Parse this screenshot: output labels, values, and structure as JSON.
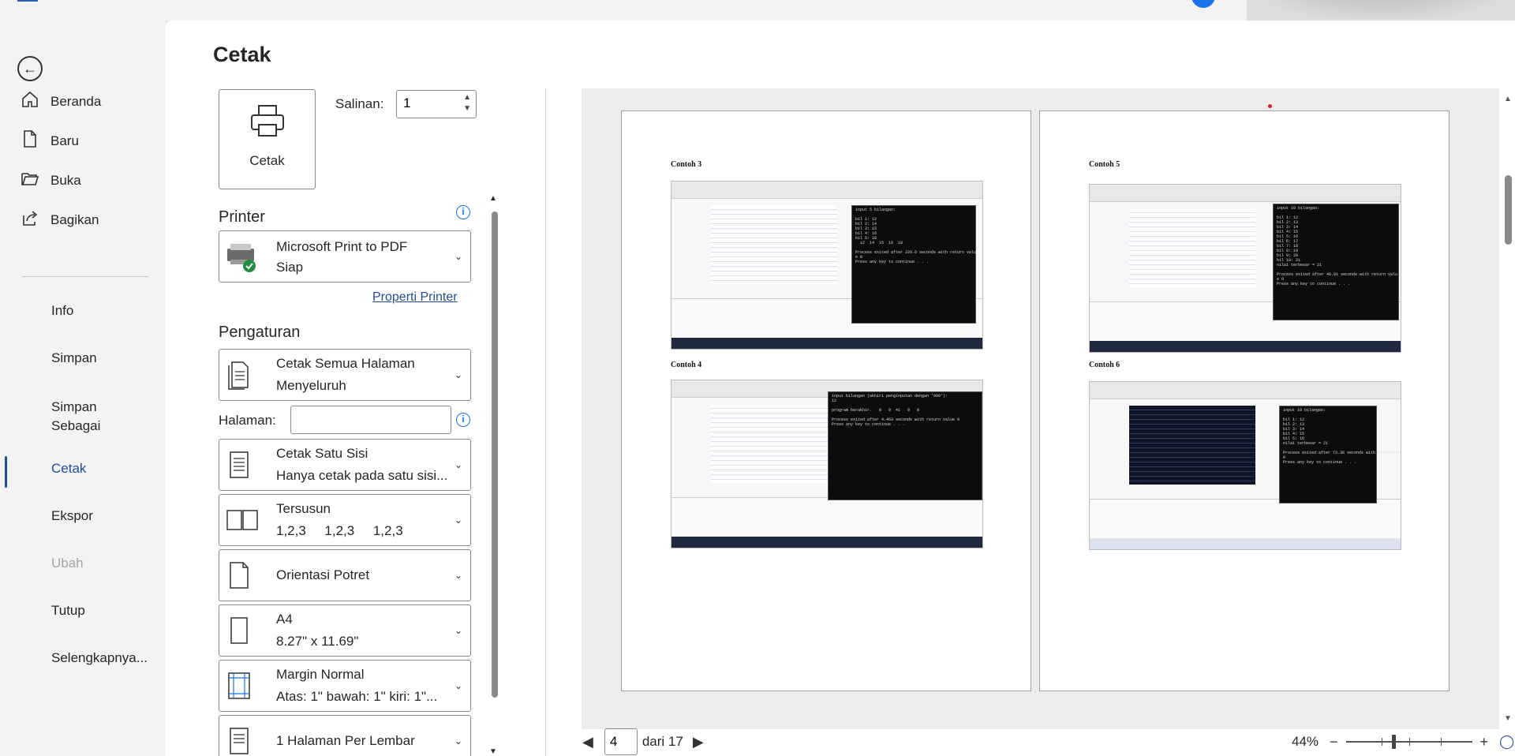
{
  "sidebar": {
    "nav": [
      {
        "label": "Beranda",
        "icon": "home-icon"
      },
      {
        "label": "Baru",
        "icon": "new-document-icon"
      },
      {
        "label": "Buka",
        "icon": "folder-icon"
      },
      {
        "label": "Bagikan",
        "icon": "share-icon"
      }
    ],
    "items": [
      "Info",
      "Simpan",
      "Simpan Sebagai",
      "Cetak",
      "Ekspor",
      "Ubah",
      "Tutup",
      "Selengkapnya..."
    ],
    "active": "Cetak",
    "disabled": "Ubah"
  },
  "print": {
    "title": "Cetak",
    "print_button": "Cetak",
    "copies_label": "Salinan:",
    "copies_value": "1",
    "printer_heading": "Printer",
    "printer_name": "Microsoft Print to PDF",
    "printer_status": "Siap",
    "printer_properties": "Properti Printer",
    "settings_heading": "Pengaturan",
    "pages_label": "Halaman:",
    "pages_value": "",
    "settings": [
      {
        "line1": "Cetak Semua Halaman",
        "line2": "Menyeluruh"
      },
      {
        "line1": "Cetak Satu Sisi",
        "line2": "Hanya cetak pada satu sisi..."
      },
      {
        "line1": "Tersusun",
        "line2": "1,2,3     1,2,3     1,2,3"
      },
      {
        "line1": "Orientasi Potret",
        "line2": ""
      },
      {
        "line1": "A4",
        "line2": "8.27\" x 11.69\""
      },
      {
        "line1": "Margin Normal",
        "line2": "Atas: 1\" bawah: 1\" kiri: 1\"..."
      },
      {
        "line1": "1 Halaman Per Lembar",
        "line2": ""
      }
    ]
  },
  "preview": {
    "left_page": {
      "examples": [
        {
          "title": "Contoh 3",
          "console": "input 5 bilangan:\n\nbil 1: 12\nbil 2: 14\nbil 3: 15\nbil 4: 16\nbil 5: 18\n  12  14  15  16  18\n\nProcess exited after 226.6 seconds with return valu\ne 0\nPress any key to continue . . ."
        },
        {
          "title": "Contoh 4",
          "console": "input bilangan (akhiri penginputan dengan '999'):\n12\n\nprogram berakhir.   0   0  41   0   0\n\nProcess exited after 4.463 seconds with return value 0\nPress any key to continue . . ."
        }
      ]
    },
    "right_page": {
      "examples": [
        {
          "title": "Contoh 5",
          "console": "input 10 bilangan:\n\nbil 1: 12\nbil 2: 13\nbil 3: 14\nbil 4: 15\nbil 5: 16\nbil 6: 17\nbil 7: 18\nbil 8: 19\nbil 9: 20\nbil 10: 21\nnilai terbesar = 21\n\nProcess exited after 40.01 seconds with return valu\ne 0\nPress any key to continue . . ."
        },
        {
          "title": "Contoh 6",
          "console": "input 10 bilangan:\n\nbil 1: 12\nbil 2: 13\nbil 3: 14\nbil 4: 15\nbil 5: 16\nnilai terbesar = 21\n\nProcess exited after 73.36 seconds with return value\n0\nPress any key to continue . . ."
        }
      ]
    },
    "current_page": "4",
    "of_label": "dari 17",
    "zoom": "44%",
    "zoom_level": 0.44
  }
}
